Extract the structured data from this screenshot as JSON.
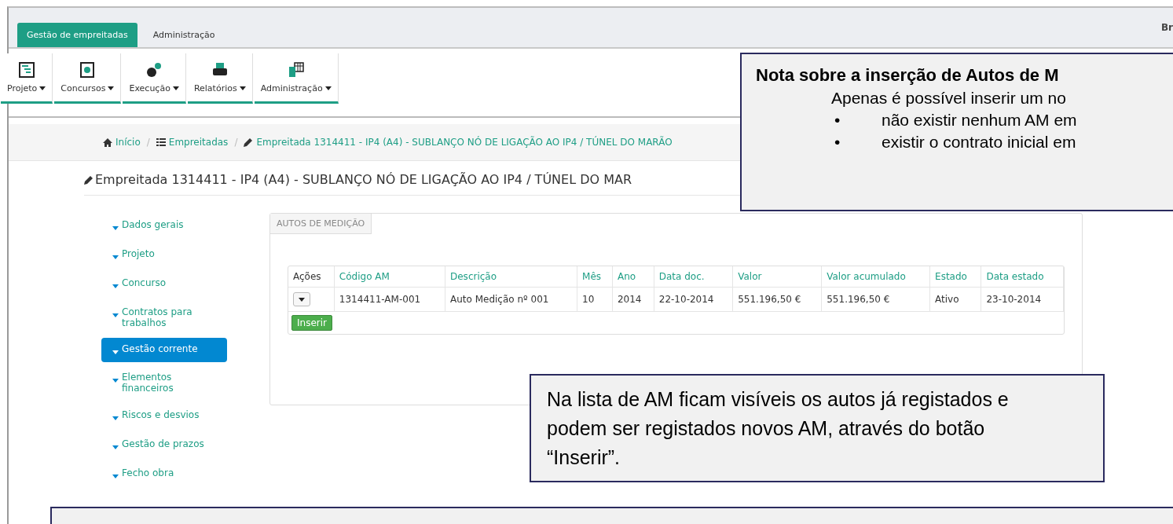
{
  "top_tabs": [
    {
      "label": "Gestão de empreitadas",
      "selected": true
    },
    {
      "label": "Administração",
      "selected": false
    }
  ],
  "user_label": "Br",
  "toolbar": [
    {
      "label": "Projeto"
    },
    {
      "label": "Concursos"
    },
    {
      "label": "Execução"
    },
    {
      "label": "Relatórios"
    },
    {
      "label": "Administração"
    }
  ],
  "breadcrumb": {
    "separator": "/",
    "items": [
      {
        "label": "Início"
      },
      {
        "label": "Empreitadas"
      },
      {
        "label": "Empreitada 1314411 - IP4 (A4) - SUBLANÇO NÓ DE LIGAÇÃO AO IP4 / TÚNEL DO MARÃO"
      }
    ]
  },
  "page_title": "Empreitada 1314411 - IP4 (A4) - SUBLANÇO NÓ DE LIGAÇÃO AO IP4 / TÚNEL DO MAR",
  "sidebar": {
    "items": [
      {
        "label": "Dados gerais",
        "selected": false
      },
      {
        "label": "Projeto",
        "selected": false
      },
      {
        "label": "Concurso",
        "selected": false
      },
      {
        "label": "Contratos para trabalhos",
        "selected": false
      },
      {
        "label": "Gestão corrente",
        "selected": true
      },
      {
        "label": "Elementos financeiros",
        "selected": false
      },
      {
        "label": "Riscos e desvios",
        "selected": false
      },
      {
        "label": "Gestão de prazos",
        "selected": false
      },
      {
        "label": "Fecho obra",
        "selected": false
      }
    ]
  },
  "panel": {
    "tab": "AUTOS DE MEDIÇÃO",
    "table": {
      "columns": [
        "Ações",
        "Código AM",
        "Descrição",
        "Mês",
        "Ano",
        "Data doc.",
        "Valor",
        "Valor acumulado",
        "Estado",
        "Data estado"
      ],
      "rows": [
        [
          "",
          "1314411-AM-001",
          "Auto Medição nº 001",
          "10",
          "2014",
          "22-10-2014",
          "551.196,50 €",
          "551.196,50 €",
          "Ativo",
          "23-10-2014"
        ]
      ]
    },
    "insert_button": "Inserir"
  },
  "callouts": [
    {
      "kind": "top",
      "title": "Nota sobre a inserção de Autos de M",
      "intro": "Apenas é possível inserir um no",
      "bullet_mark": "•",
      "bullets": [
        "não existir nenhum AM em",
        "existir o contrato inicial em"
      ]
    },
    {
      "kind": "middle",
      "text": "Na lista de AM ficam visíveis os autos já registados e podem ser registados novos AM, através do botão “Inserir”."
    },
    {
      "kind": "bottom"
    }
  ]
}
